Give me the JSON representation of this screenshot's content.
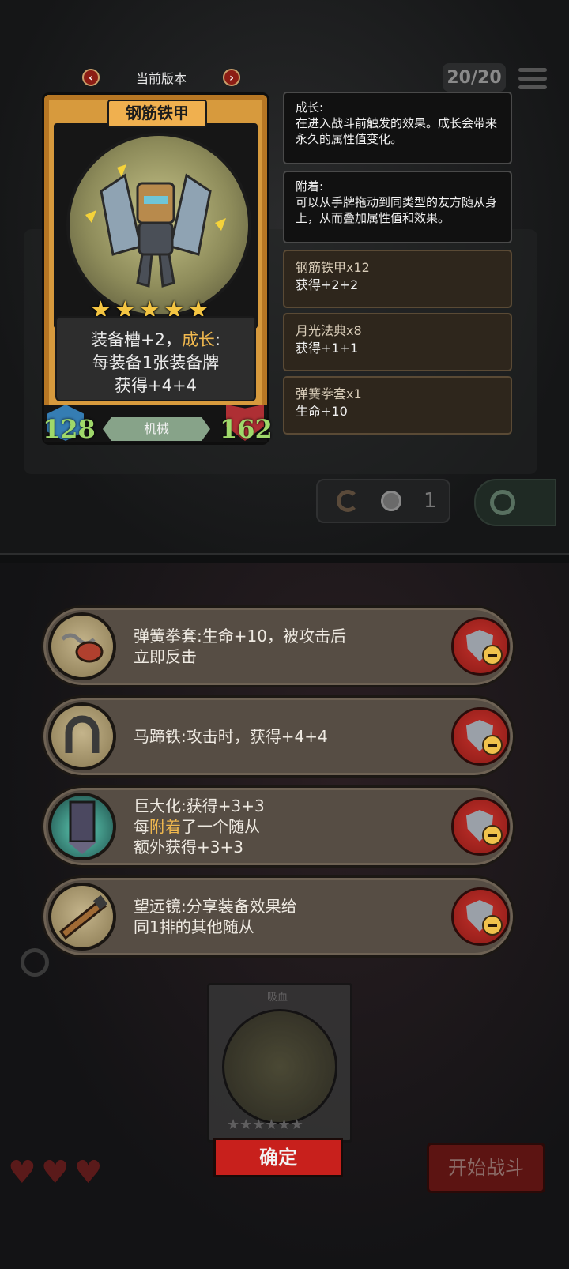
{
  "hud": {
    "deck_count": "20/20"
  },
  "refresh": {
    "coin_count": "1"
  },
  "version": {
    "label": "当前版本",
    "prev_icon": "chevron-left-icon",
    "next_icon": "chevron-right-icon"
  },
  "card": {
    "name": "钢筋铁甲",
    "stars": 5,
    "desc_line1_prefix": "装备槽+2，",
    "desc_line1_keyword": "成长",
    "desc_line1_suffix": ":",
    "desc_line2": "每装备1张装备牌",
    "desc_line3": "获得+4+4",
    "attack": "128",
    "health": "162",
    "tribe": "机械"
  },
  "tooltips": [
    {
      "title": "成长:",
      "body": "在进入战斗前触发的效果。成长会带来永久的属性值变化。"
    },
    {
      "title": "附着:",
      "body": "可以从手牌拖动到同类型的友方随从身上，从而叠加属性值和效果。"
    }
  ],
  "history": [
    {
      "name": "钢筋铁甲x12",
      "effect": "获得+2+2"
    },
    {
      "name": "月光法典x8",
      "effect": "获得+1+1"
    },
    {
      "name": "弹簧拳套x1",
      "effect": "生命+10"
    }
  ],
  "equipment": [
    {
      "icon": "spring-glove-icon",
      "line1": "弹簧拳套:生命+10，被攻击后",
      "line2": "立即反击",
      "line3": ""
    },
    {
      "icon": "horseshoe-icon",
      "line1": "马蹄铁:攻击时，获得+4+4",
      "line2": "",
      "line3": ""
    },
    {
      "icon": "giantize-icon",
      "line1": "巨大化:获得+3+3",
      "line2_prefix": "每",
      "line2_keyword": "附着",
      "line2_suffix": "了一个随从",
      "line3": "额外获得+3+3"
    },
    {
      "icon": "telescope-icon",
      "line1": "望远镜:分享装备效果给",
      "line2": "同1排的其他随从",
      "line3": ""
    }
  ],
  "mini_card": {
    "name": "吸血",
    "stars": "★★★★★★"
  },
  "buttons": {
    "confirm": "确定",
    "start_battle": "开始战斗"
  },
  "lives": {
    "hearts": "♥♥♥"
  },
  "colors": {
    "accent_gold": "#f0b84e",
    "stat_green": "#9fd86a",
    "confirm_red": "#c8201c"
  }
}
